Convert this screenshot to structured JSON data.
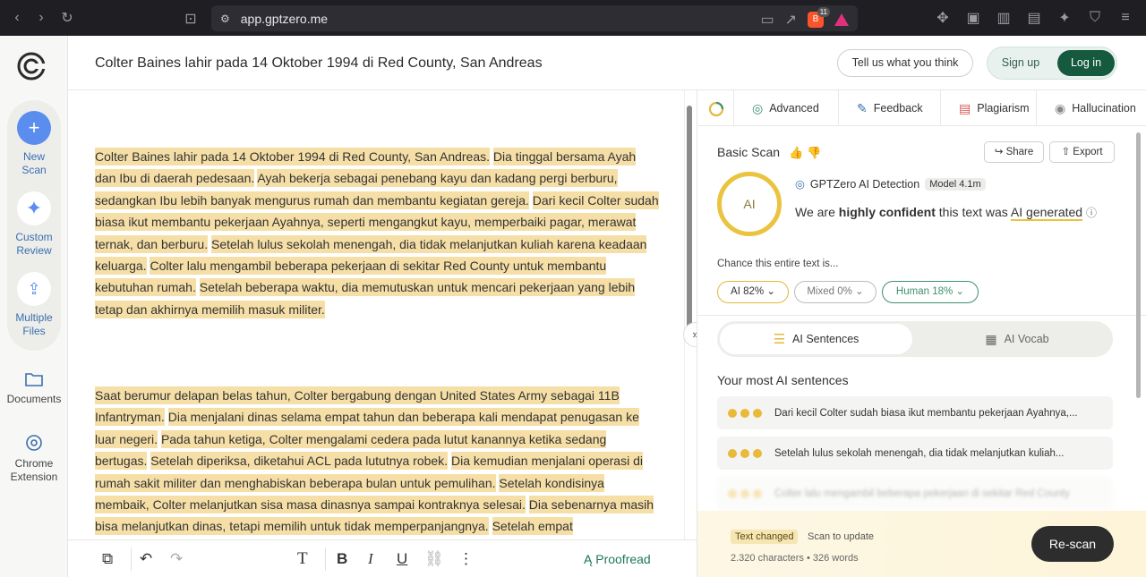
{
  "browser": {
    "url": "app.gptzero.me",
    "brave_badge": "11"
  },
  "sidebar": {
    "tools": [
      {
        "label": "New\nScan"
      },
      {
        "label": "Custom\nReview"
      },
      {
        "label": "Multiple\nFiles"
      }
    ],
    "documents_label": "Documents",
    "extension_label": "Chrome\nExtension"
  },
  "header": {
    "title": "Colter Baines lahir pada 14 Oktober 1994 di Red County, San Andreas",
    "feedback_label": "Tell us what you think",
    "signup_label": "Sign up",
    "login_label": "Log in"
  },
  "editor": {
    "paragraph1": [
      "Colter Baines lahir pada 14 Oktober 1994 di Red County, San Andreas.",
      "Dia tinggal bersama Ayah dan Ibu di daerah pedesaan.",
      "Ayah bekerja sebagai penebang kayu dan kadang pergi berburu, sedangkan Ibu lebih banyak mengurus rumah dan membantu kegiatan gereja.",
      "Dari kecil Colter sudah biasa ikut membantu pekerjaan Ayahnya, seperti mengangkut kayu, memperbaiki pagar, merawat ternak, dan berburu.",
      "Setelah lulus sekolah menengah, dia tidak melanjutkan kuliah karena keadaan keluarga.",
      "Colter lalu mengambil beberapa pekerjaan di sekitar Red County untuk membantu kebutuhan rumah.",
      "Setelah beberapa waktu, dia memutuskan untuk mencari pekerjaan yang lebih tetap dan akhirnya memilih masuk militer."
    ],
    "paragraph2": [
      "Saat berumur delapan belas tahun, Colter bergabung dengan United States Army sebagai 11B Infantryman.",
      "Dia menjalani dinas selama empat tahun dan beberapa kali mendapat penugasan ke luar negeri.",
      "Pada tahun ketiga, Colter mengalami cedera pada lutut kanannya ketika sedang bertugas.",
      "Setelah diperiksa, diketahui ACL pada lututnya robek.",
      "Dia kemudian menjalani operasi di rumah sakit militer dan menghabiskan beberapa bulan untuk pemulihan.",
      "Setelah kondisinya membaik, Colter melanjutkan sisa masa dinasnya sampai kontraknya selesai.",
      "Dia sebenarnya masih bisa melanjutkan dinas, tetapi memilih untuk tidak memperpanjangnya.",
      "Setelah empat"
    ]
  },
  "toolbar": {
    "proofread_label": "Proofread"
  },
  "panel": {
    "tabs": [
      {
        "label": "Advanced"
      },
      {
        "label": "Feedback"
      },
      {
        "label": "Plagiarism"
      },
      {
        "label": "Hallucination"
      }
    ],
    "basic_scan_label": "Basic Scan",
    "share_label": "Share",
    "export_label": "Export",
    "ring_label": "AI",
    "detection_label": "GPTZero AI Detection",
    "model_label": "Model 4.1m",
    "confidence_prefix": "We are",
    "confidence_bold": "highly confident",
    "confidence_mid": "this text was",
    "confidence_result": "AI generated",
    "chance_label": "Chance this entire text is...",
    "pills": {
      "ai": "AI 82%",
      "mixed": "Mixed 0%",
      "human": "Human 18%"
    },
    "seg_on": "AI Sentences",
    "seg_off": "AI Vocab",
    "most_ai_title": "Your most AI sentences",
    "sentences": [
      "Dari kecil Colter sudah biasa ikut membantu pekerjaan Ayahnya,...",
      "Setelah lulus sekolah menengah, dia tidak melanjutkan kuliah...",
      "Colter lalu mengambil beberapa pekerjaan di sekitar Red County"
    ],
    "text_changed": "Text changed",
    "scan_to_update": "Scan to update",
    "counts": "2.320 characters • 326 words",
    "rescan_label": "Re-scan",
    "colors": {
      "ai": "#eac33f",
      "human": "#3e8f6c",
      "login": "#15593f"
    }
  }
}
